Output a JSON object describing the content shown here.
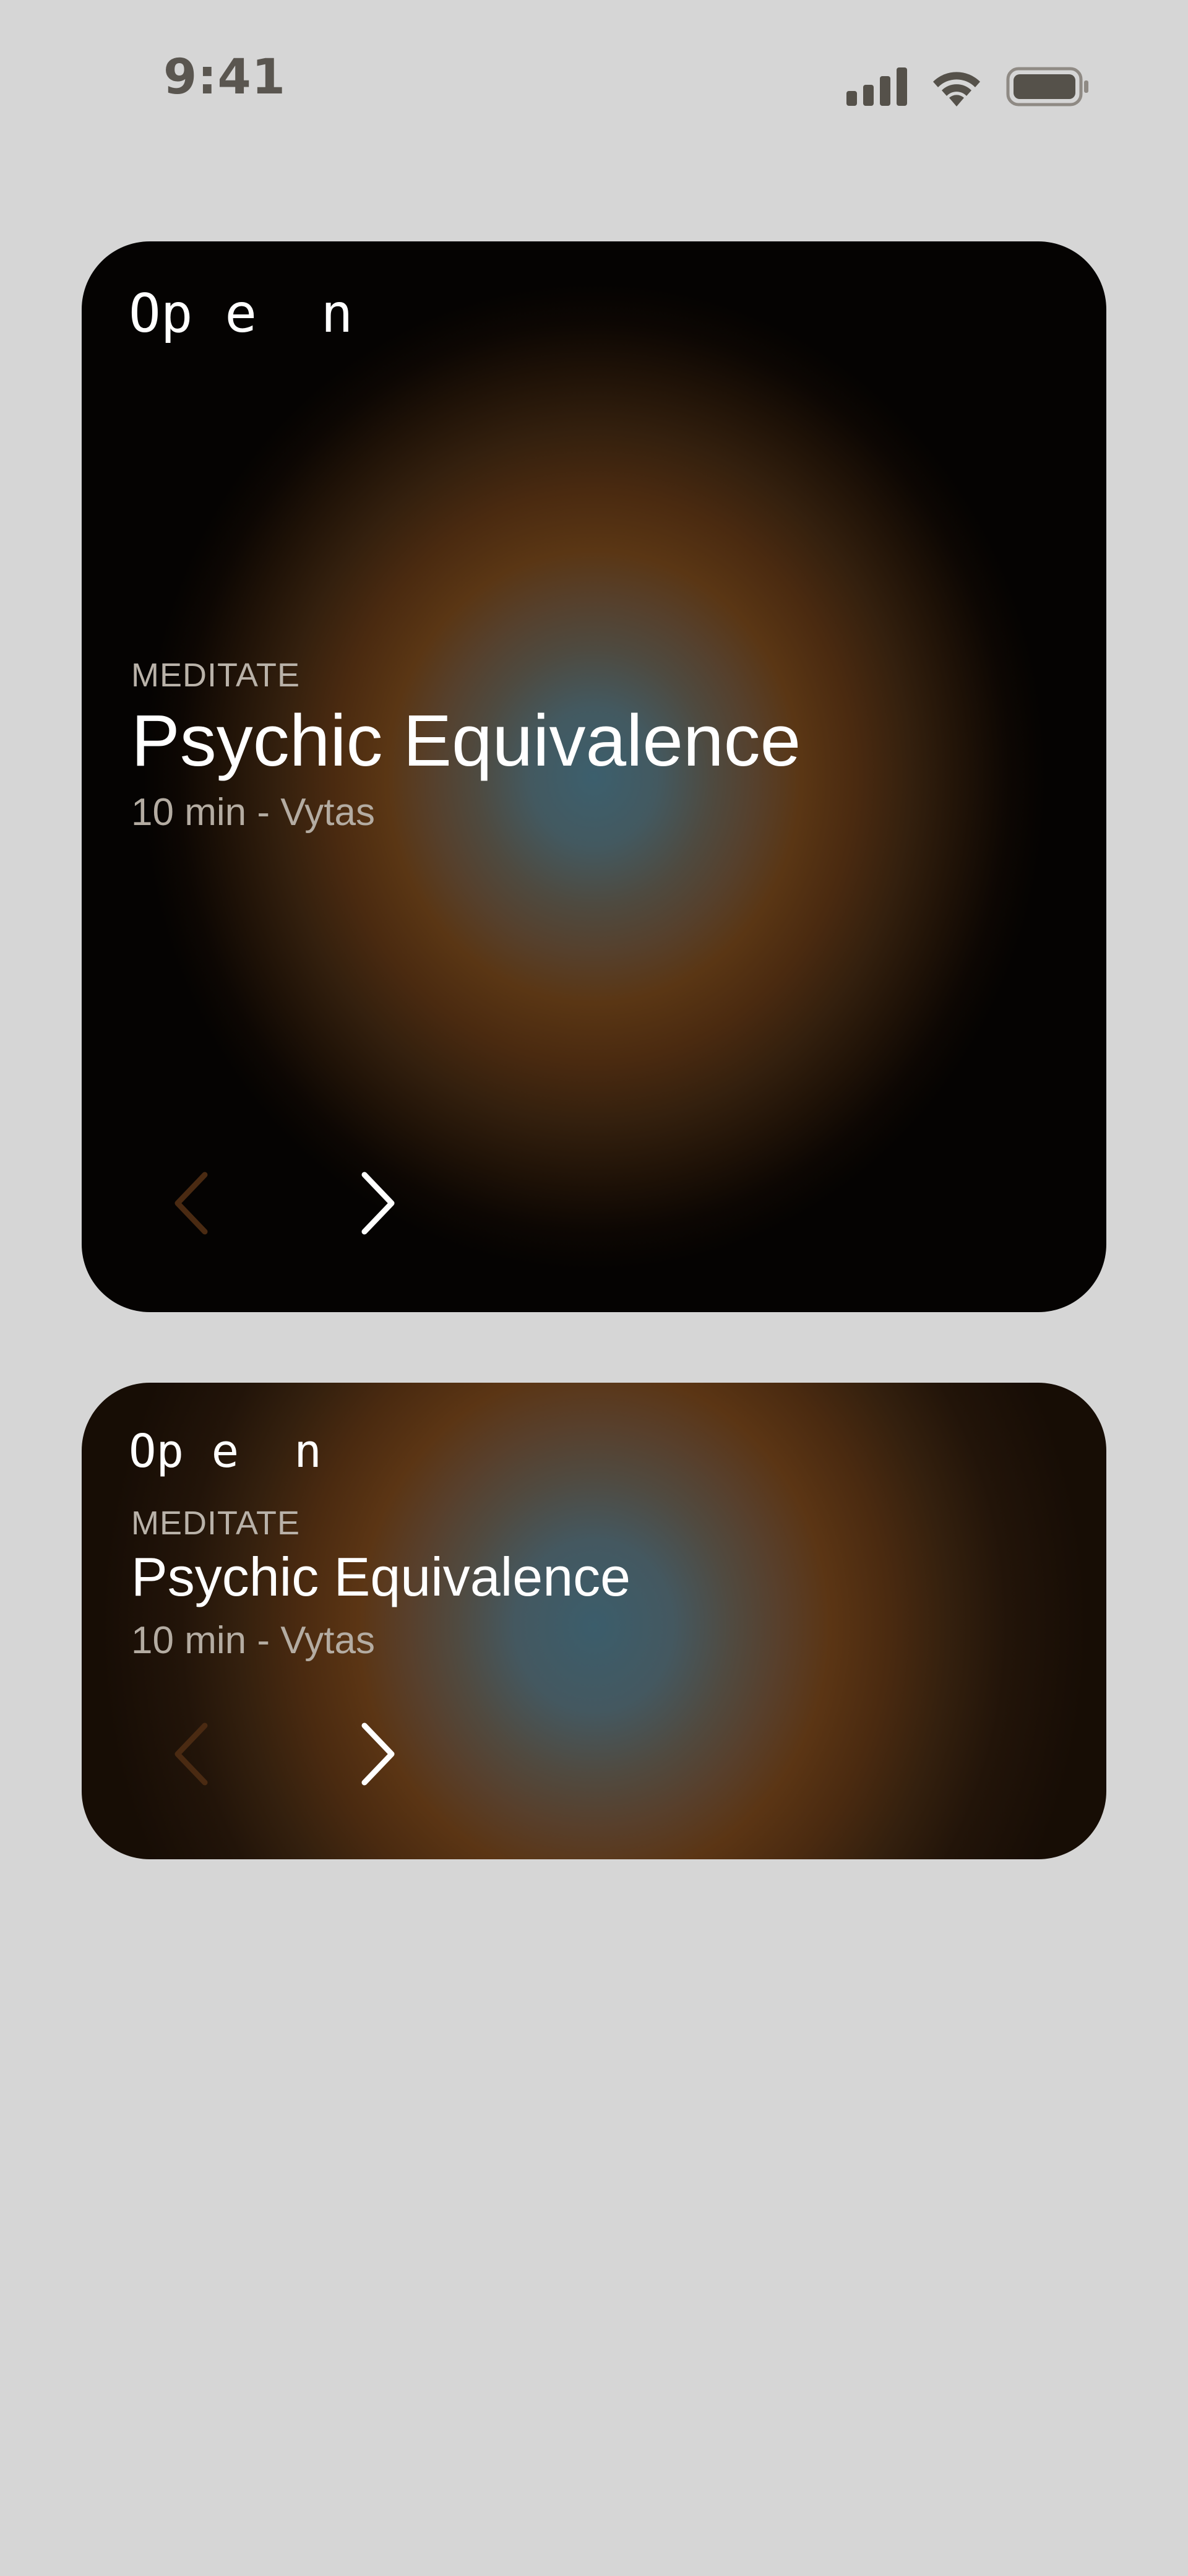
{
  "status_bar": {
    "time": "9:41",
    "icons": [
      "signal-icon",
      "wifi-icon",
      "battery-icon"
    ]
  },
  "cards": [
    {
      "variant": "large",
      "open_label": "Op e  n",
      "category": "MEDITATE",
      "title": "Psychic Equivalence",
      "meta": "10 min - Vytas",
      "nav": {
        "prev_icon": "chevron-left-icon",
        "next_icon": "chevron-right-icon"
      }
    },
    {
      "variant": "small",
      "open_label": "Op e  n",
      "category": "MEDITATE",
      "title": "Psychic Equivalence",
      "meta": "10 min - Vytas",
      "nav": {
        "prev_icon": "chevron-left-icon",
        "next_icon": "chevron-right-icon"
      }
    }
  ],
  "colors": {
    "background": "#d6d6d6",
    "status_text": "#5a5650",
    "card_center": "#3c5f6d",
    "card_mid": "#5a3614",
    "card_edge": "#050302",
    "text_primary": "#ffffff",
    "text_secondary": "#b4aca2",
    "chevron_disabled": "#4a2a12"
  }
}
